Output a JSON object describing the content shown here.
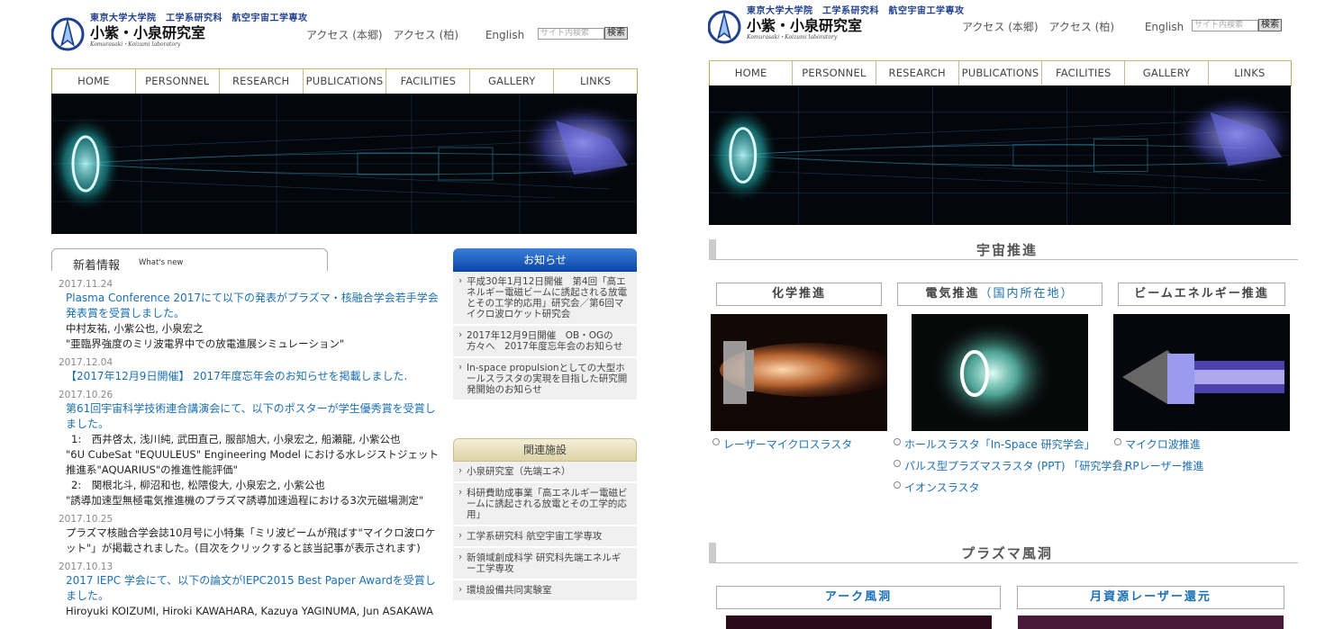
{
  "header": {
    "logo_sub": "東京大学大学院　工学系研究科　航空宇宙工学専攻",
    "logo_main": "小紫・小泉研究室",
    "logo_roman": "Komurasaki・Koizumi laboratory",
    "links": [
      "アクセス (本郷)",
      "アクセス (柏)",
      "English"
    ],
    "search_placeholder": "サイト内検索",
    "search_button": "検索"
  },
  "nav": [
    "HOME",
    "PERSONNEL",
    "RESEARCH",
    "PUBLICATIONS",
    "FACILITIES",
    "GALLERY",
    "LINKS"
  ],
  "whats_new": {
    "title": "新着情報",
    "subtitle": "What's new",
    "entries": [
      {
        "date": "2017.11.24",
        "link": "Plasma Conference 2017にて以下の発表がプラズマ・核融合学会若手学会発表賞を受賞しました。",
        "lines": [
          "中村友祐, 小紫公也, 小泉宏之",
          "\"亜臨界強度のミリ波電界中での放電進展シミュレーション\""
        ]
      },
      {
        "date": "2017.12.04",
        "link": "【2017年12月9日開催】 2017年度忘年会のお知らせを掲載しました.",
        "lines": []
      },
      {
        "date": "2017.10.26",
        "link": "第61回宇宙科学技術連合講演会にて、以下のポスターが学生優秀賞を受賞しました。",
        "lines": [
          "1:　西井啓太, 浅川純, 武田直己, 服部旭大, 小泉宏之, 船瀬龍, 小紫公也",
          "\"6U CubeSat \"EQUULEUS\" Engineering Model における水レジストジェット推進系\"AQUARIUS\"の推進性能評価\"",
          "2:　関根北斗, 柳沼和也, 松隈俊大, 小泉宏之, 小紫公也",
          "\"誘導加速型無極電気推進機のプラズマ誘導加速過程における3次元磁場測定\""
        ]
      },
      {
        "date": "2017.10.25",
        "link": "",
        "lines": [
          "プラズマ核融合学会誌10月号に小特集「ミリ波ビームが飛ばす\"マイクロ波ロケット\"」が掲載されました。(目次をクリックすると該当記事が表示されます)"
        ]
      },
      {
        "date": "2017.10.13",
        "link": "2017 IEPC 学会にて、以下の論文がIEPC2015 Best Paper Awardを受賞しました。",
        "lines": [
          "Hiroyuki KOIZUMI, Hiroki KAWAHARA, Kazuya YAGINUMA, Jun ASAKAWA"
        ]
      }
    ]
  },
  "notice": {
    "title": "お知らせ",
    "items": [
      "平成30年1月12日開催　第4回「高エネルギー電磁ビームに誘起される放電とその工学的応用」研究会／第6回マイクロ波ロケット研究会",
      "2017年12月9日開催　OB・OGの方々へ　2017年度忘年会のお知らせ",
      "In-space propulsionとしての大型ホールスラスタの実現を目指した研究開発開始のお知らせ"
    ]
  },
  "related": {
    "title": "関連施設",
    "items": [
      "小泉研究室（先端エネ）",
      "科研費助成事業「高エネルギー電磁ビームに誘起される放電とその工学的応用」",
      "工学系研究科 航空宇宙工学専攻",
      "新領域創成科学 研究科先端エネルギー工学専攻",
      "環境設備共同実験室"
    ]
  },
  "research": {
    "section1": "宇宙推進",
    "categories": [
      {
        "label": "化学推進",
        "note": ""
      },
      {
        "label": "電気推進",
        "note": "（国内所在地）"
      },
      {
        "label": "ビームエネルギー推進",
        "note": ""
      }
    ],
    "links_col1": [
      "レーザーマイクロスラスタ"
    ],
    "links_col2": [
      "ホールスラスタ「In-Space 研究学会」",
      "パルス型プラズマスラスタ (PPT) 「研究学会」",
      "イオンスラスタ"
    ],
    "links_col3": [
      "マイクロ波推進",
      "RPレーザー推進"
    ],
    "section2": "プラズマ風洞",
    "categories2": [
      "アーク風洞",
      "月資源レーザー還元"
    ]
  },
  "colors": {
    "link": "#1a6fb6",
    "nav_border": "#bba95e",
    "notice_header": "#0a46a8"
  }
}
